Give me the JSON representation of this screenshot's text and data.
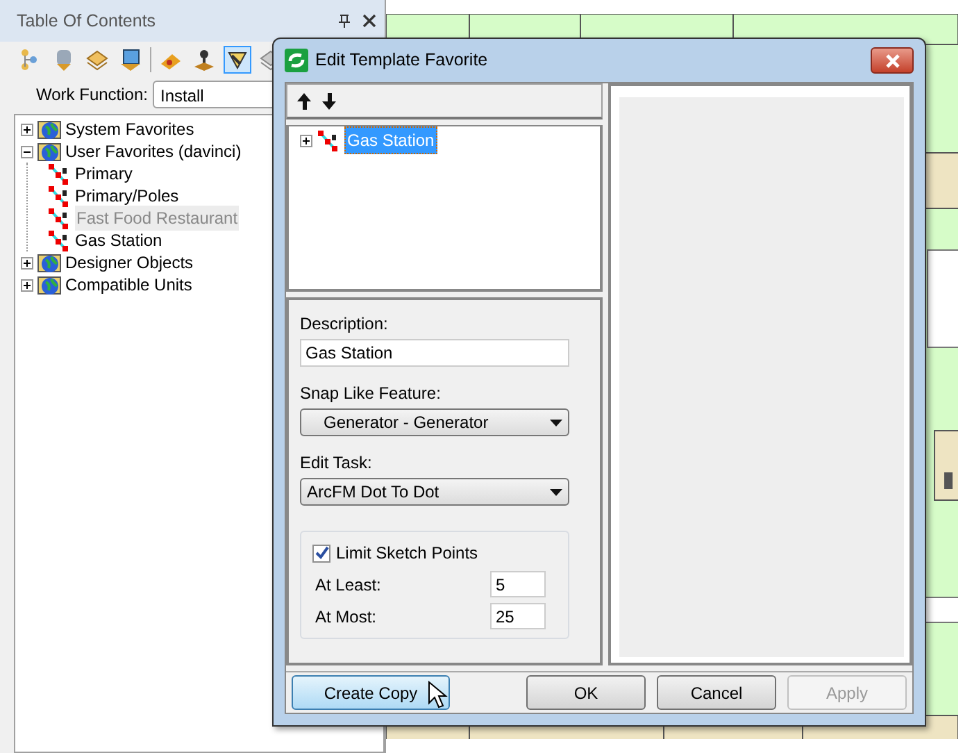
{
  "toc": {
    "title": "Table Of Contents",
    "tools": [
      {
        "kind": "tree",
        "selected": false
      },
      {
        "kind": "database",
        "selected": false
      },
      {
        "kind": "layers",
        "selected": false
      },
      {
        "kind": "layer-edit",
        "selected": false
      },
      {
        "kind": "separator"
      },
      {
        "kind": "brush",
        "selected": false
      },
      {
        "kind": "stamp",
        "selected": false
      },
      {
        "kind": "template",
        "selected": true
      },
      {
        "kind": "layers-faded",
        "selected": false
      }
    ],
    "work_function": {
      "label": "Work Function:",
      "value": "Install"
    },
    "tree": [
      {
        "label": "System Favorites",
        "expanded": false
      },
      {
        "label": "User Favorites (davinci)",
        "expanded": true,
        "children": [
          {
            "label": "Primary",
            "dimmed": false
          },
          {
            "label": "Primary/Poles",
            "dimmed": false
          },
          {
            "label": "Fast Food Restaurant",
            "dimmed": true
          },
          {
            "label": "Gas Station",
            "dimmed": false
          }
        ]
      },
      {
        "label": "Designer Objects",
        "expanded": false
      },
      {
        "label": "Compatible Units",
        "expanded": false
      }
    ]
  },
  "dialog": {
    "title": "Edit Template Favorite",
    "tree": [
      {
        "label": "Gas Station",
        "selected": true,
        "expanded": false
      }
    ],
    "description": {
      "label": "Description:",
      "value": "Gas Station"
    },
    "snap": {
      "label": "Snap Like Feature:",
      "value": "Generator - Generator"
    },
    "edit_task": {
      "label": "Edit Task:",
      "value": "ArcFM Dot To Dot"
    },
    "limit": {
      "label": "Limit Sketch Points",
      "checked": true
    },
    "at_least": {
      "label": "At Least:",
      "value": "5"
    },
    "at_most": {
      "label": "At Most:",
      "value": "25"
    },
    "buttons": [
      {
        "label": "Create Copy",
        "hovered": true,
        "disabled": false
      },
      {
        "label": "OK",
        "hovered": false,
        "disabled": false
      },
      {
        "label": "Cancel",
        "hovered": false,
        "disabled": false
      },
      {
        "label": "Apply",
        "hovered": false,
        "disabled": true
      }
    ]
  }
}
